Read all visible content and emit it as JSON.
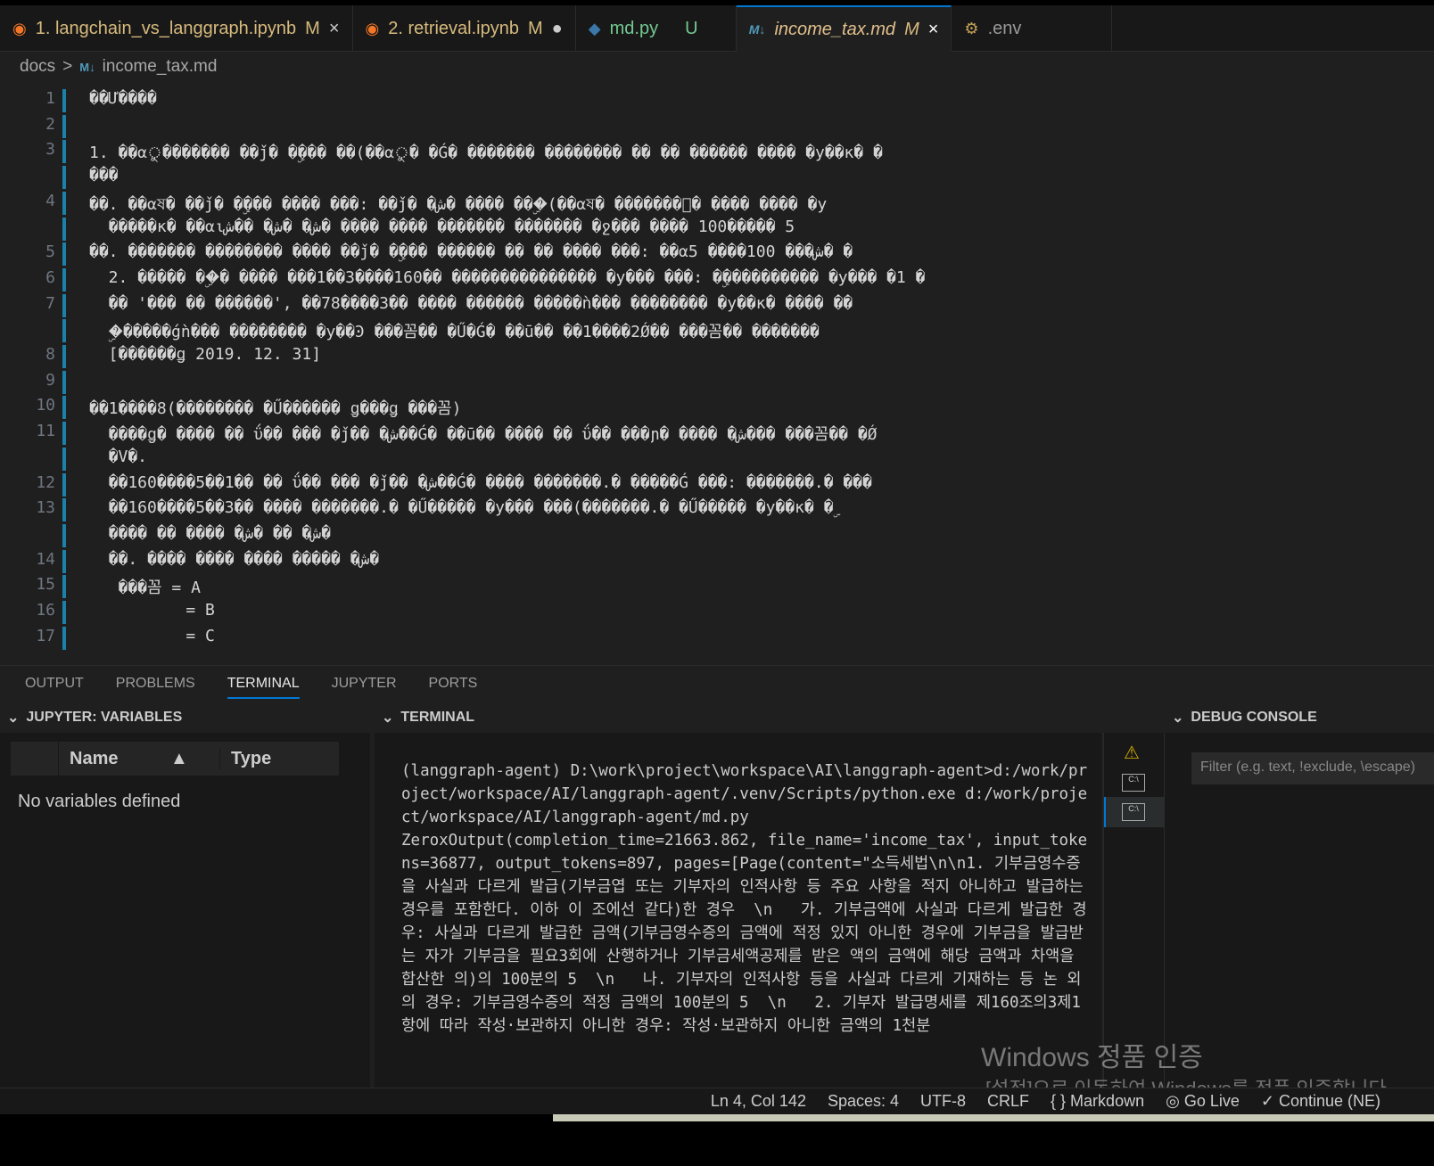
{
  "tabs": [
    {
      "label": "1. langchain_vs_langgraph.ipynb",
      "badge": "M",
      "icon": "jupyter-icon",
      "action": "×"
    },
    {
      "label": "2. retrieval.ipynb",
      "badge": "M",
      "icon": "jupyter-icon",
      "action": "●"
    },
    {
      "label": "md.py",
      "badge": "U",
      "icon": "python-icon",
      "action": ""
    },
    {
      "label": "income_tax.md",
      "badge": "M",
      "icon": "markdown-icon",
      "action": "×"
    },
    {
      "label": ".env",
      "badge": "",
      "icon": "env-icon",
      "action": ""
    }
  ],
  "breadcrumb": {
    "folder": "docs",
    "sep": ">",
    "file": "income_tax.md",
    "file_icon": "M↓"
  },
  "editor": {
    "lines": [
      {
        "n": "1",
        "text": "��Ư����"
      },
      {
        "n": "2",
        "text": ""
      },
      {
        "n": "3",
        "text": "1. ��αু������� ��ǰ� �ۣ��� ��(��αু� �Ǵ� ������� �������� �� �� ������ ���� �y��ĸ� �"
      },
      {
        "n": "",
        "text": "���"
      },
      {
        "n": "4",
        "text": "��. ��αষ� ��ǰ� �ۣ��� ���� ���: ��ǰ� �ش� ���� ���ۣ(��αষ� �������ু� ���� ���� �y"
      },
      {
        "n": "",
        "text": "  �����ĸ� ��αιش� �ش� ��ش� ���� ���� ������� ������� �ջ��� ���� 100����� 5"
      },
      {
        "n": "5",
        "text": "��. ������� �������� ���� ��ǰ� �ۣ��� ������ �� �� ���� ���: ��α5 ����100 ���ش� �"
      },
      {
        "n": "6",
        "text": "  2. ����� ��ۣ� ���� ���1��3����160�� ��������������� �y��� ���: �ۣ���������� �y��� �1 �"
      },
      {
        "n": "7",
        "text": "  �� '��� �� ������', ��78����3�� ���� ������ �����ǹ��� �������� �y��ĸ� ���� ��"
      },
      {
        "n": "",
        "text": "  �ۣ�����ǵǹ��� �������� �y��Ͽ ���꼼�� �Ű�Ǵ� ��ū�� ��1����2Ǿ�� ���꼼�� �������"
      },
      {
        "n": "8",
        "text": "  [������ǥ 2019. 12. 31]"
      },
      {
        "n": "9",
        "text": ""
      },
      {
        "n": "10",
        "text": "��1����8(�������� �Ű������ ǥ���ǥ ���꼼)"
      },
      {
        "n": "11",
        "text": "  ����ǥ� ���� �� ΰ�� ��� �ǰ�� �ش��Ǵ� ��ū�� ���� �� ΰ�� ���ɲ� ���� �ش��� ���꼼�� �Ǿ"
      },
      {
        "n": "",
        "text": "  �V�."
      },
      {
        "n": "12",
        "text": "  ��160����5��1�� �� ΰ�� ��� �ǰ�� �ش��Ǵ� ���� �������.� �����Ǵ ���: �������.� ���"
      },
      {
        "n": "13",
        "text": "  ��160����5��3�� ���� �������.� �Ű����� �y��� ���(�������.� �Ű����� �y��ĸ� �ۣ"
      },
      {
        "n": "",
        "text": "  ���� �� ���� �ش� �� �ش�"
      },
      {
        "n": "14",
        "text": "  ��. ���� ���� ���� ����� �ش�"
      },
      {
        "n": "15",
        "text": "   ���꼼 = A"
      },
      {
        "n": "16",
        "text": "          = B"
      },
      {
        "n": "17",
        "text": "          = C"
      }
    ]
  },
  "panel": {
    "tabs": [
      "OUTPUT",
      "PROBLEMS",
      "TERMINAL",
      "JUPYTER",
      "PORTS"
    ],
    "active": "TERMINAL"
  },
  "variables": {
    "title": "JUPYTER: VARIABLES",
    "col_name": "Name",
    "col_type": "Type",
    "sort_icon": "▲",
    "empty": "No variables defined"
  },
  "terminal": {
    "title": "TERMINAL",
    "output": "(langgraph-agent) D:\\work\\project\\workspace\\AI\\langgraph-agent>d:/work/project/workspace/AI/langgraph-agent/.venv/Scripts/python.exe d:/work/project/workspace/AI/langgraph-agent/md.py\nZeroxOutput(completion_time=21663.862, file_name='income_tax', input_tokens=36877, output_tokens=897, pages=[Page(content=\"소득세법\\n\\n1. 기부금영수증을 사실과 다르게 발급(기부금엽 또는 기부자의 인적사항 등 주요 사항을 적지 아니하고 발급하는 경우를 포함한다. 이하 이 조에선 같다)한 경우  \\n   가. 기부금액에 사실과 다르게 발급한 경우: 사실과 다르게 발급한 금액(기부금영수증의 금액에 적정 있지 아니한 경우에 기부금을 발급받는 자가 기부금을 필요3회에 산행하거나 기부금세액공제를 받은 액의 금액에 해당 금액과 차액을 합산한 의)의 100분의 5  \\n   나. 기부자의 인적사항 등을 사실과 다르게 기재하는 등 논 외의 경우: 기부금영수증의 적정 금액의 100분의 5  \\n   2. 기부자 발급명세를 제160조의3제1항에 따라 작성·보관하지 아니한 경우: 작성·보관하지 아니한 금액의 1천분"
  },
  "debug": {
    "title": "DEBUG CONSOLE",
    "filter_placeholder": "Filter (e.g. text, !exclude, \\escape)"
  },
  "status": {
    "position": "Ln 4, Col 142",
    "spaces": "Spaces: 4",
    "encoding": "UTF-8",
    "eol": "CRLF",
    "language": "{ } Markdown",
    "golive": "Go Live",
    "continue": "✓ Continue (NE)"
  },
  "watermark": {
    "line1": "Windows 정품 인증",
    "line2": "[설정]으로 이동하여 Windows를 정품 인증합니다."
  }
}
